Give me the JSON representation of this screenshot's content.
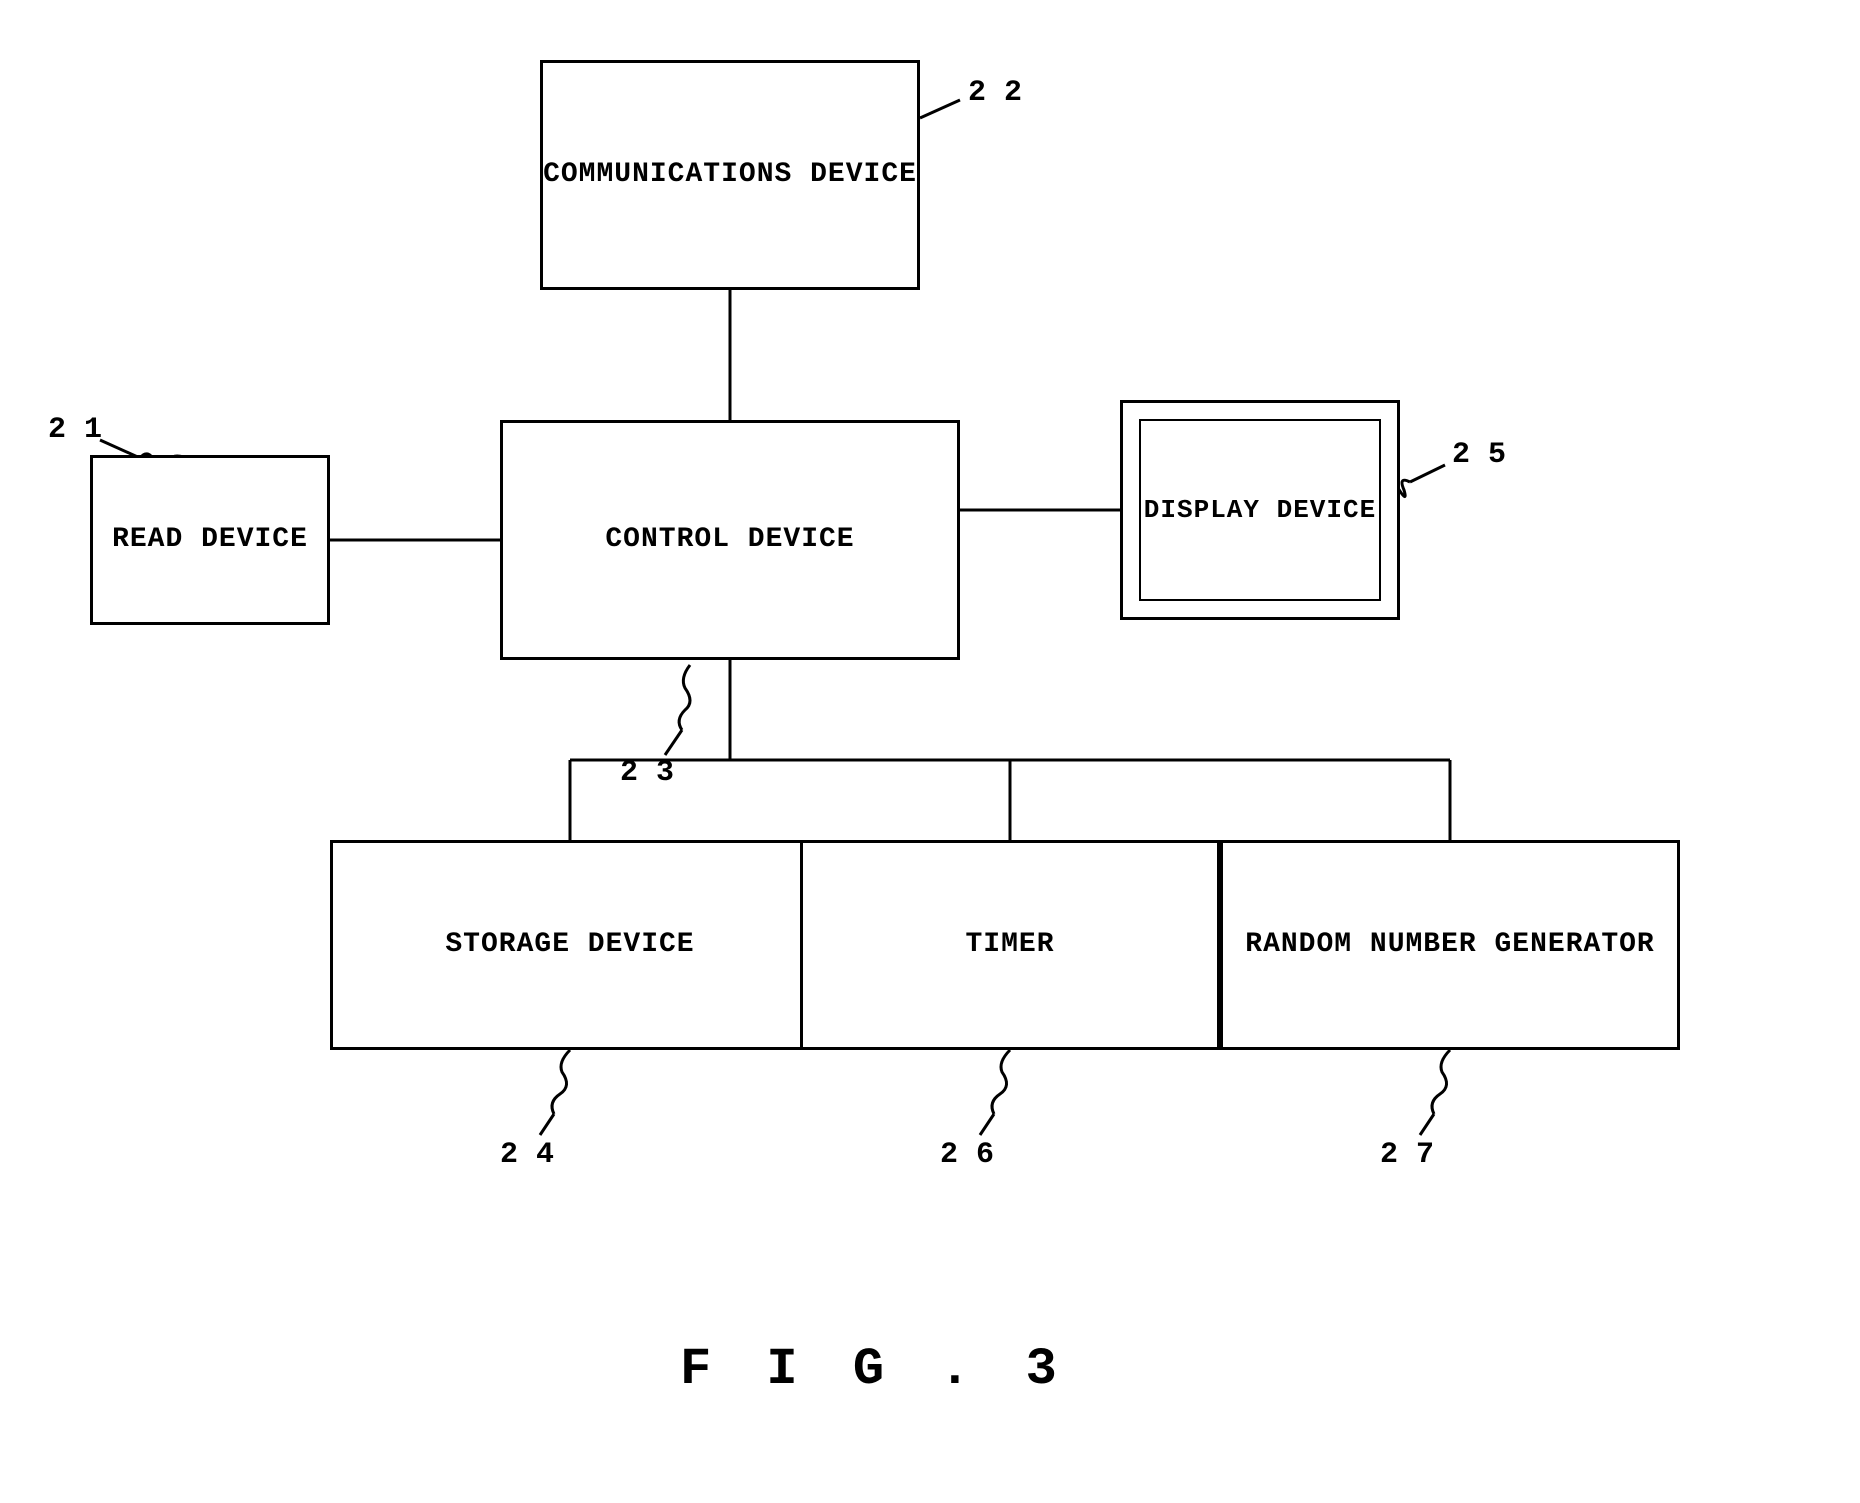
{
  "diagram": {
    "title": "FIG. 3",
    "nodes": {
      "communications_device": {
        "label": "COMMUNICATIONS\nDEVICE",
        "ref": "22"
      },
      "control_device": {
        "label": "CONTROL DEVICE",
        "ref": "23"
      },
      "read_device": {
        "label": "READ DEVICE",
        "ref": "21"
      },
      "display_device": {
        "label": "DISPLAY\nDEVICE",
        "ref": "25"
      },
      "storage_device": {
        "label": "STORAGE DEVICE",
        "ref": "24"
      },
      "timer": {
        "label": "TIMER",
        "ref": "26"
      },
      "random_number_generator": {
        "label": "RANDOM NUMBER\nGENERATOR",
        "ref": "27"
      }
    },
    "figure_label": "F I G . 3"
  }
}
